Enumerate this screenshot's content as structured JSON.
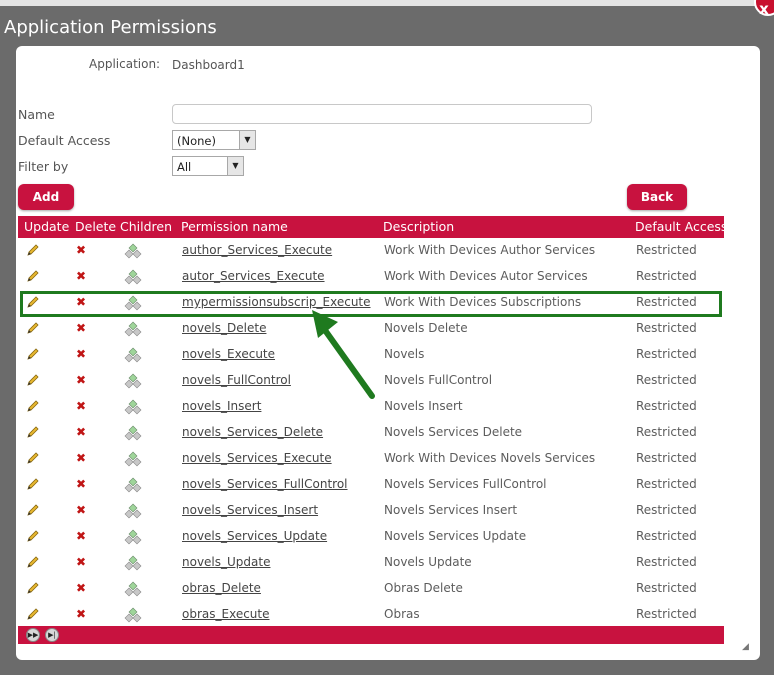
{
  "window": {
    "title": "Application Permissions",
    "close_glyph": "x"
  },
  "application": {
    "label": "Application:",
    "value": "Dashboard1"
  },
  "filters": {
    "name_label": "Name",
    "name_value": "",
    "default_access_label": "Default Access",
    "default_access_value": "(None)",
    "filter_by_label": "Filter by",
    "filter_by_value": "All"
  },
  "buttons": {
    "add": "Add",
    "back": "Back"
  },
  "grid": {
    "headers": {
      "update": "Update",
      "delete": "Delete",
      "children": "Children",
      "name": "Permission name",
      "description": "Description",
      "default": "Default Access"
    },
    "rows": [
      {
        "name": "author_Services_Execute",
        "description": "Work With Devices Author Services",
        "default": "Restricted"
      },
      {
        "name": "autor_Services_Execute",
        "description": "Work With Devices Autor Services",
        "default": "Restricted"
      },
      {
        "name": "mypermissionsubscrip_Execute",
        "description": "Work With Devices Subscriptions",
        "default": "Restricted"
      },
      {
        "name": "novels_Delete",
        "description": "Novels Delete",
        "default": "Restricted"
      },
      {
        "name": "novels_Execute",
        "description": "Novels",
        "default": "Restricted"
      },
      {
        "name": "novels_FullControl",
        "description": "Novels FullControl",
        "default": "Restricted"
      },
      {
        "name": "novels_Insert",
        "description": "Novels Insert",
        "default": "Restricted"
      },
      {
        "name": "novels_Services_Delete",
        "description": "Novels Services Delete",
        "default": "Restricted"
      },
      {
        "name": "novels_Services_Execute",
        "description": "Work With Devices Novels Services",
        "default": "Restricted"
      },
      {
        "name": "novels_Services_FullControl",
        "description": "Novels Services FullControl",
        "default": "Restricted"
      },
      {
        "name": "novels_Services_Insert",
        "description": "Novels Services Insert",
        "default": "Restricted"
      },
      {
        "name": "novels_Services_Update",
        "description": "Novels Services Update",
        "default": "Restricted"
      },
      {
        "name": "novels_Update",
        "description": "Novels Update",
        "default": "Restricted"
      },
      {
        "name": "obras_Delete",
        "description": "Obras Delete",
        "default": "Restricted"
      },
      {
        "name": "obras_Execute",
        "description": "Obras",
        "default": "Restricted"
      }
    ],
    "highlighted_row": 2
  },
  "icons": {
    "update": "pencil-icon",
    "delete": "delete-x-icon",
    "children": "children-icon",
    "pager_next": "next-page-icon",
    "pager_last": "last-page-icon"
  },
  "colors": {
    "accent": "#c8123f",
    "highlight": "#1f7a1f",
    "close": "#c8102e"
  }
}
